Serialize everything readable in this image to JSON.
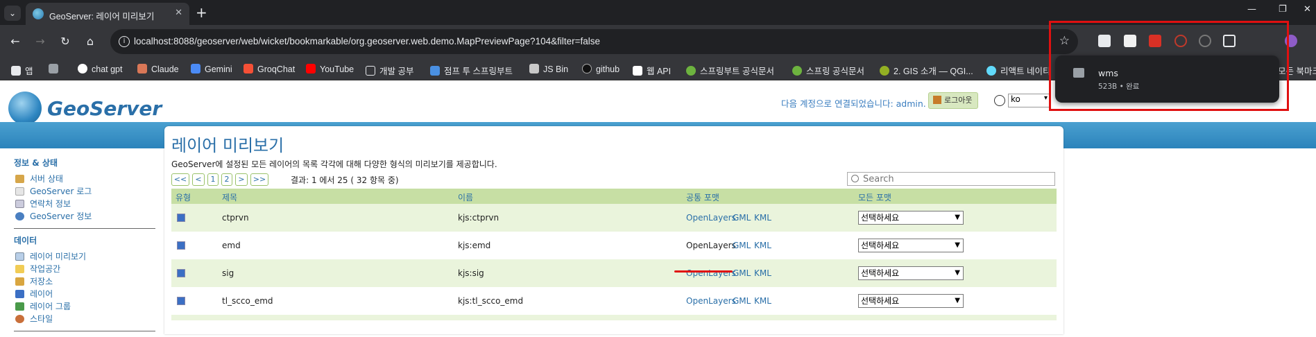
{
  "browser": {
    "tab_title": "GeoServer: 레이어 미리보기",
    "url": "localhost:8088/geoserver/web/wicket/bookmarkable/org.geoserver.web.demo.MapPreviewPage?104&filter=false",
    "bookmarks": [
      "앱",
      "chat gpt",
      "Claude",
      "Gemini",
      "GroqChat",
      "YouTube",
      "개발 공부",
      "점프 투 스프링부트",
      "JS Bin",
      "github",
      "웹 API",
      "스프링부트 공식문서",
      "스프링 공식문서",
      "2. GIS 소개 — QGI...",
      "리액트 네이티",
      "모든 북마크"
    ]
  },
  "download": {
    "filename": "wms",
    "status": "523B • 완료"
  },
  "header": {
    "logo_text": "GeoServer",
    "login_info": "다음 계정으로 연결되었습니다: admin.",
    "logout_label": "로그아웃",
    "language": "ko"
  },
  "sidebar": {
    "section1_title": "정보 & 상태",
    "section1_items": [
      "서버 상태",
      "GeoServer 로그",
      "연락처 정보",
      "GeoServer 정보"
    ],
    "section2_title": "데이터",
    "section2_items": [
      "레이어 미리보기",
      "작업공간",
      "저장소",
      "레이어",
      "레이어 그룹",
      "스타일"
    ]
  },
  "main": {
    "title": "레이어 미리보기",
    "description": "GeoServer에 설정된 모든 레이어의 목록 각각에 대해 다양한 형식의 미리보기를 제공합니다.",
    "pager": [
      "<<",
      "<",
      "1",
      "2",
      ">",
      ">>"
    ],
    "result_text": "결과: 1 에서 25 ( 32 항목 중)",
    "search_placeholder": "Search",
    "columns": [
      "유형",
      "제목",
      "이름",
      "공통 포맷",
      "모든 포맷"
    ],
    "rows": [
      {
        "title": "ctprvn",
        "name": "kjs:ctprvn",
        "openlayers": "OpenLayers",
        "gml": "GML",
        "kml": "KML",
        "select": "선택하세요"
      },
      {
        "title": "emd",
        "name": "kjs:emd",
        "openlayers": "OpenLayers",
        "gml": "GML",
        "kml": "KML",
        "select": "선택하세요"
      },
      {
        "title": "sig",
        "name": "kjs:sig",
        "openlayers": "OpenLayers",
        "gml": "GML",
        "kml": "KML",
        "select": "선택하세요"
      },
      {
        "title": "tl_scco_emd",
        "name": "kjs:tl_scco_emd",
        "openlayers": "OpenLayers",
        "gml": "GML",
        "kml": "KML",
        "select": "선택하세요"
      }
    ]
  }
}
